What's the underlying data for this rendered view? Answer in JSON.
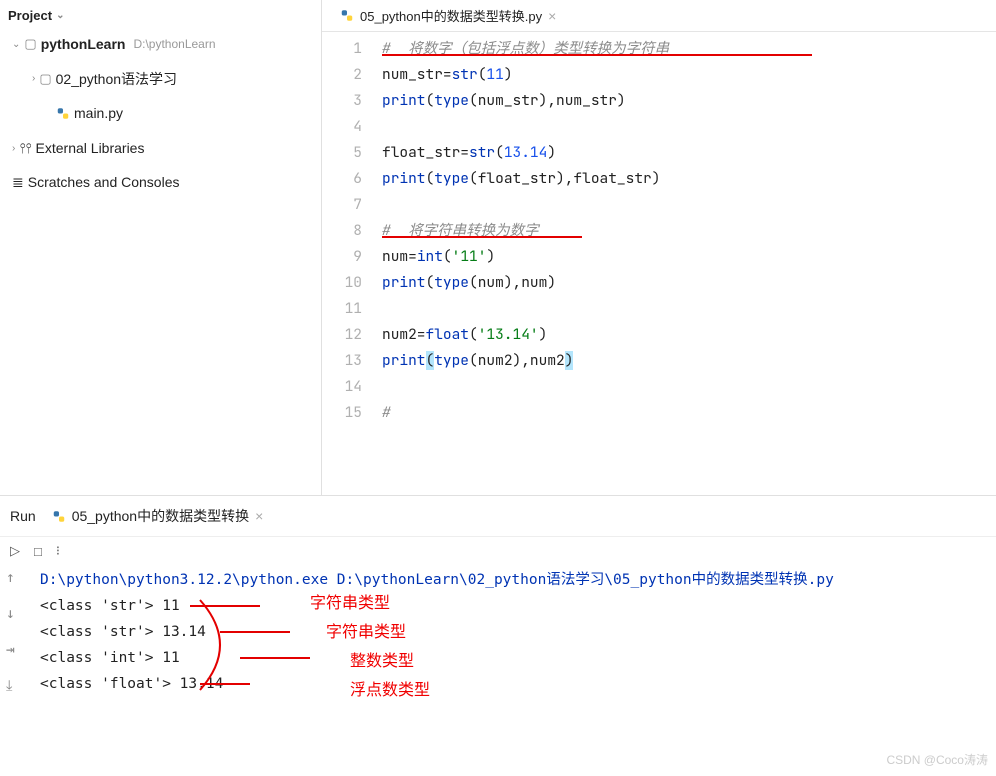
{
  "project": {
    "header": "Project",
    "root": {
      "name": "pythonLearn",
      "path": "D:\\pythonLearn"
    },
    "items": [
      {
        "name": "02_python语法学习"
      },
      {
        "name": "main.py"
      }
    ],
    "external": "External Libraries",
    "scratches": "Scratches and Consoles"
  },
  "tab": {
    "title": "05_python中的数据类型转换.py"
  },
  "code": {
    "lines": [
      {
        "n": 1,
        "type": "comment",
        "text": "#  将数字（包括浮点数）类型转换为字符串"
      },
      {
        "n": 2,
        "segs": [
          "num_str=",
          {
            "c": "builtin",
            "t": "str"
          },
          "(",
          {
            "c": "num",
            "t": "11"
          },
          ")"
        ]
      },
      {
        "n": 3,
        "segs": [
          {
            "c": "builtin",
            "t": "print"
          },
          "(",
          {
            "c": "builtin",
            "t": "type"
          },
          "(num_str),num_str)"
        ]
      },
      {
        "n": 4,
        "segs": []
      },
      {
        "n": 5,
        "segs": [
          "float_str=",
          {
            "c": "builtin",
            "t": "str"
          },
          "(",
          {
            "c": "num",
            "t": "13.14"
          },
          ")"
        ]
      },
      {
        "n": 6,
        "segs": [
          {
            "c": "builtin",
            "t": "print"
          },
          "(",
          {
            "c": "builtin",
            "t": "type"
          },
          "(float_str),float_str)"
        ]
      },
      {
        "n": 7,
        "segs": []
      },
      {
        "n": 8,
        "type": "comment",
        "text": "#  将字符串转换为数字"
      },
      {
        "n": 9,
        "segs": [
          "num=",
          {
            "c": "builtin",
            "t": "int"
          },
          "(",
          {
            "c": "str",
            "t": "'11'"
          },
          ")"
        ]
      },
      {
        "n": 10,
        "segs": [
          {
            "c": "builtin",
            "t": "print"
          },
          "(",
          {
            "c": "builtin",
            "t": "type"
          },
          "(num),num)"
        ]
      },
      {
        "n": 11,
        "segs": []
      },
      {
        "n": 12,
        "segs": [
          "num2=",
          {
            "c": "builtin",
            "t": "float"
          },
          "(",
          {
            "c": "str",
            "t": "'13.14'"
          },
          ")"
        ]
      },
      {
        "n": 13,
        "segs": [
          {
            "c": "builtin",
            "t": "print"
          },
          {
            "c": "hl",
            "t": "("
          },
          {
            "c": "builtin",
            "t": "type"
          },
          "(num2),num2",
          {
            "c": "hl",
            "t": ")"
          }
        ]
      },
      {
        "n": 14,
        "segs": []
      },
      {
        "n": 15,
        "type": "comment",
        "text": "#"
      }
    ]
  },
  "run": {
    "label": "Run",
    "tab": "05_python中的数据类型转换",
    "cmd": "D:\\python\\python3.12.2\\python.exe D:\\pythonLearn\\02_python语法学习\\05_python中的数据类型转换.py",
    "output": [
      "<class 'str'> 11",
      "<class 'str'> 13.14",
      "<class 'int'> 11",
      "<class 'float'> 13.14"
    ]
  },
  "annotations": {
    "labels": [
      "字符串类型",
      "字符串类型",
      "整数类型",
      "浮点数类型"
    ]
  },
  "watermark": "CSDN @Coco涛涛"
}
